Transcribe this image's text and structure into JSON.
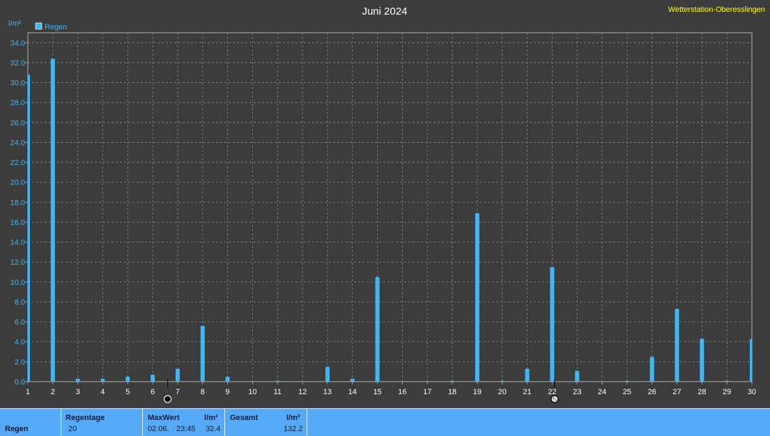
{
  "header": {
    "title": "Juni 2024",
    "station": "Wetterstation-Oberesslingen",
    "unit": "l/m²",
    "legend": "Regen"
  },
  "colors": {
    "background": "#3c3c3c",
    "plot_border": "#a0a0a0",
    "grid": "#8a8a8a",
    "bar": "#3fb7f5",
    "footer": "#55aaf7",
    "station": "#ffff00"
  },
  "chart_data": {
    "type": "bar",
    "title": "Juni 2024",
    "ylabel": "l/m²",
    "legend": [
      "Regen"
    ],
    "ylim": [
      0,
      35
    ],
    "yticks": [
      "0.0",
      "2.0",
      "4.0",
      "6.0",
      "8.0",
      "10.0",
      "12.0",
      "14.0",
      "16.0",
      "18.0",
      "20.0",
      "22.0",
      "24.0",
      "26.0",
      "28.0",
      "30.0",
      "32.0",
      "34.0"
    ],
    "categories": [
      "1",
      "2",
      "3",
      "4",
      "5",
      "6",
      "7",
      "8",
      "9",
      "10",
      "11",
      "12",
      "13",
      "14",
      "15",
      "16",
      "17",
      "18",
      "19",
      "20",
      "21",
      "22",
      "23",
      "24",
      "25",
      "26",
      "27",
      "28",
      "29",
      "30"
    ],
    "series": [
      {
        "name": "Regen",
        "values": [
          30.8,
          32.4,
          0.3,
          0.3,
          0.5,
          0.7,
          1.3,
          5.6,
          0.5,
          0,
          0.1,
          0,
          1.5,
          0.3,
          10.5,
          0,
          0,
          0.1,
          16.9,
          0.1,
          1.3,
          11.5,
          1.1,
          0,
          0.1,
          2.5,
          7.3,
          4.3,
          0.1,
          4.3
        ]
      }
    ],
    "grid": true,
    "legend_position": "top-left",
    "moon_markers": [
      {
        "day": 6.6,
        "phase": "new-moon"
      },
      {
        "day": 22.1,
        "phase": "full-moon"
      }
    ]
  },
  "footer": {
    "row_label": "Regen",
    "regentage_label": "Regentage",
    "regentage_value": "20",
    "maxwert_label": "MaxWert",
    "maxwert_unit": "l/m²",
    "maxwert_date": "02.06.",
    "maxwert_time": "23:45",
    "maxwert_value": "32.4",
    "gesamt_label": "Gesamt",
    "gesamt_unit": "l/m²",
    "gesamt_value": "132.2"
  }
}
